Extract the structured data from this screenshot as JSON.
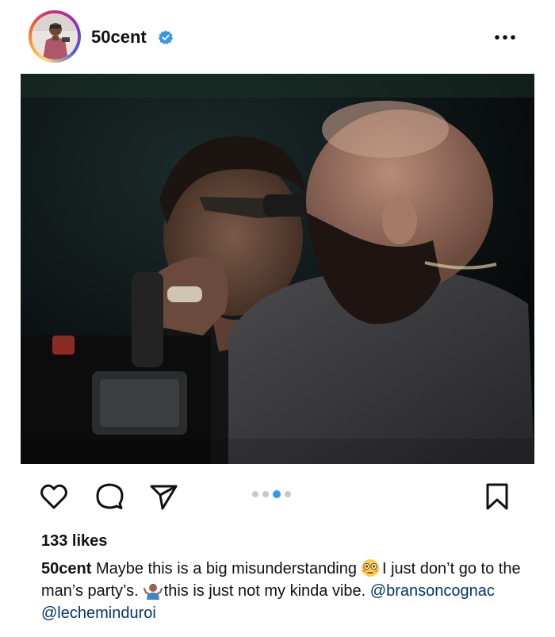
{
  "post": {
    "username": "50cent",
    "verified": true,
    "avatar_icon": "profile-photo",
    "more_icon": "more-options-icon",
    "photo_description_icon": "post-photo",
    "actions": {
      "like_icon": "heart-icon",
      "comment_icon": "comment-icon",
      "share_icon": "share-icon",
      "save_icon": "bookmark-icon"
    },
    "carousel": {
      "total": 4,
      "active_index": 2
    },
    "likes_text": "133 likes",
    "caption": {
      "username": "50cent",
      "text_part1": "Maybe this is a big misunderstanding",
      "emoji1": "flushed-face-emoji",
      "text_part2": "I just don’t go to the man’s party’s.",
      "emoji2": "person-shrugging-emoji",
      "text_part3": "this is just not my kinda vibe.",
      "mention1": "@bransoncognac",
      "mention2": "@lecheminduroi"
    },
    "colors": {
      "verified_blue": "#3897f0",
      "mention_blue": "#00376b",
      "dot_active": "#3897f0",
      "dot_inactive": "#c8c8c8"
    }
  }
}
